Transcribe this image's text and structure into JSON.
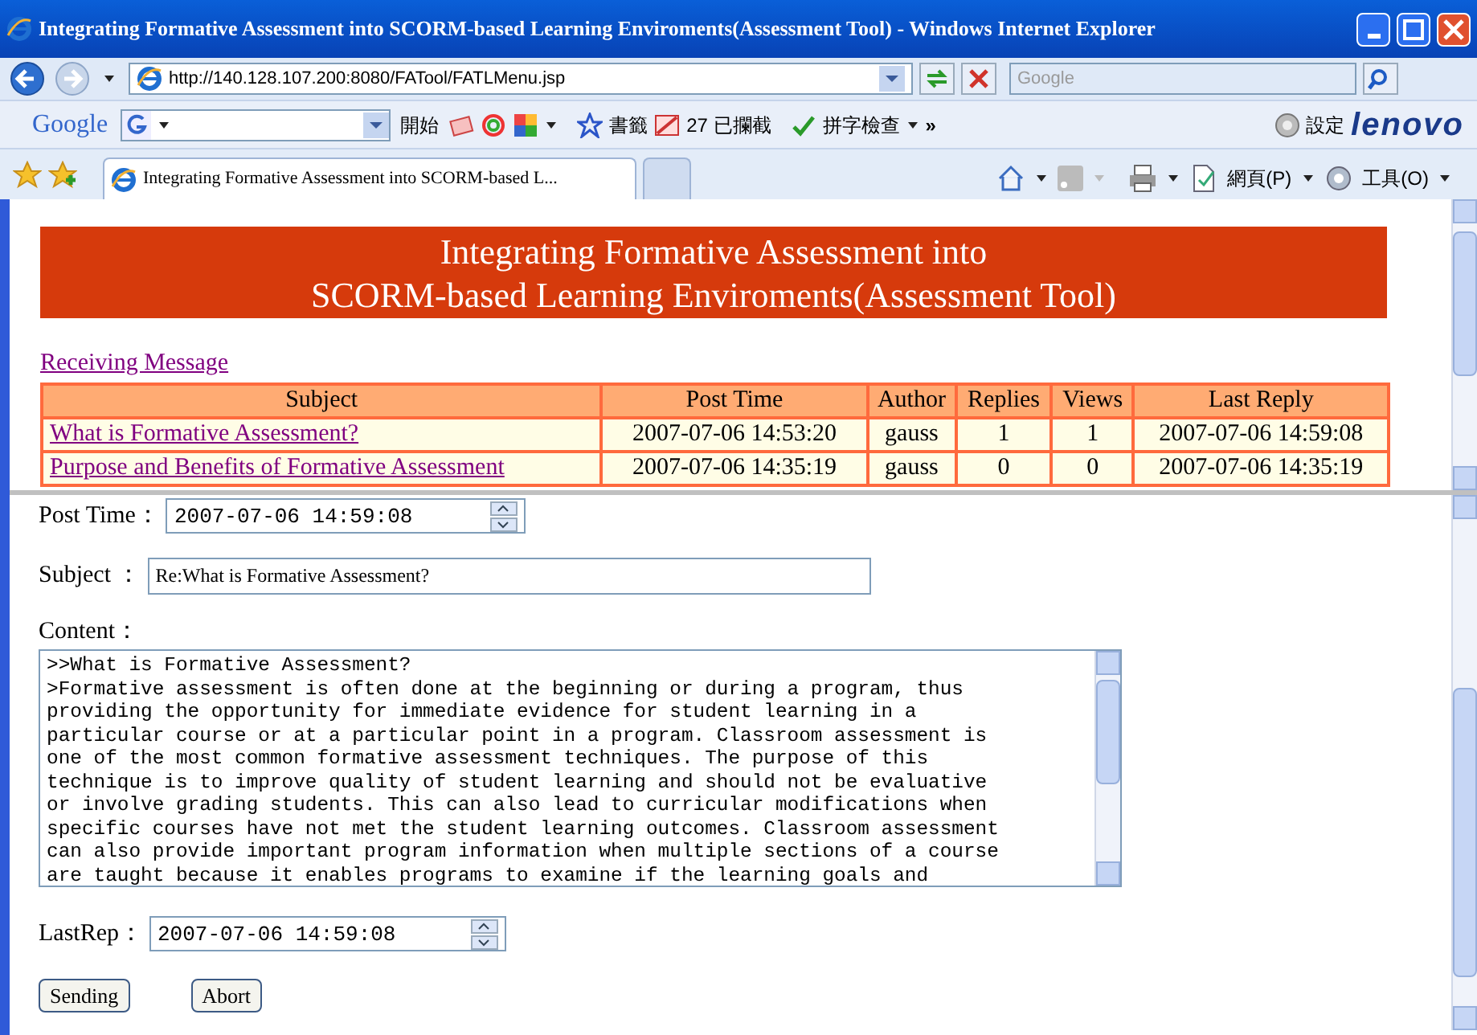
{
  "window": {
    "title": "Integrating Formative Assessment into SCORM-based Learning Enviroments(Assessment Tool) - Windows Internet Explorer"
  },
  "address_bar": {
    "url": "http://140.128.107.200:8080/FATool/FATLMenu.jsp",
    "search_placeholder": "Google"
  },
  "google_toolbar": {
    "logo": "Google",
    "go_label": "開始",
    "bookmarks": "書籤",
    "blocked": "27 已攔截",
    "spellcheck": "拼字檢查",
    "more": "»",
    "settings": "設定",
    "brand": "lenovo"
  },
  "tabs": [
    {
      "label": "Integrating Formative Assessment into SCORM-based L...",
      "selected": true
    },
    {
      "selected": false
    }
  ],
  "command_bar": {
    "page_menu": "網頁(P)",
    "tools_menu": "工具(O)"
  },
  "banner": {
    "lines": [
      "Integrating Formative Assessment into",
      "SCORM-based Learning Enviroments(Assessment Tool)"
    ]
  },
  "section_link": "Receiving Message",
  "table": {
    "columns": [
      "Subject",
      "Post Time",
      "Author",
      "Replies",
      "Views",
      "Last Reply"
    ],
    "rows": [
      [
        "What is Formative Assessment?",
        "2007-07-06 14:53:20",
        "gauss",
        "1",
        "1",
        "2007-07-06 14:59:08"
      ],
      [
        "Purpose and Benefits of Formative Assessment",
        "2007-07-06 14:35:19",
        "gauss",
        "0",
        "0",
        "2007-07-06 14:35:19"
      ]
    ]
  },
  "form": {
    "post_time_label": "Post Time：",
    "post_time": "2007-07-06 14:59:08",
    "subject_label": "Subject ：",
    "subject": "Re:What is Formative Assessment?",
    "content_label": "Content：",
    "content_lines": [
      ">>What is Formative Assessment?",
      ">Formative assessment is often done at the beginning or during a program, thus",
      "providing the opportunity for immediate evidence for student learning in a",
      "particular course or at a particular point in a program. Classroom assessment is",
      "one of the most common formative assessment techniques. The purpose of this",
      "technique is to improve quality of student learning and should not be evaluative",
      "or involve grading students. This can also lead to curricular modifications when",
      "specific courses have not met the student learning outcomes. Classroom assessment",
      "can also provide important program information when multiple sections of a course",
      "are taught because it enables programs to examine if the learning goals and"
    ],
    "last_rep_label": "LastRep：",
    "last_rep": "2007-07-06 14:59:08"
  },
  "buttons": [
    "Sending",
    "Abort"
  ]
}
